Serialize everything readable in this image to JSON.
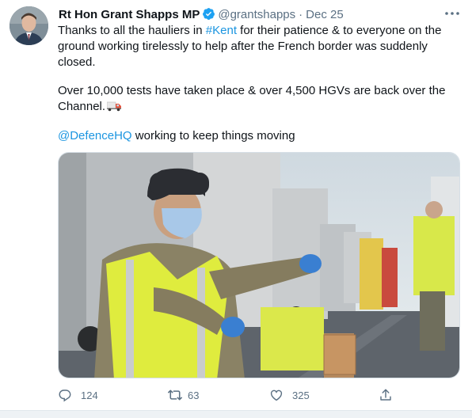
{
  "tweet": {
    "author_name": "Rt Hon Grant Shapps MP",
    "handle": "@grantshapps",
    "separator": "·",
    "date": "Dec 25",
    "text_line1_a": "Thanks to all the hauliers in ",
    "hashtag": "#Kent",
    "text_line1_b": " for their patience & to everyone on the ground working tirelessly to help after the French border was suddenly closed.",
    "text_line2": "Over 10,000 tests have taken place & over 4,500 HGVs are back over the Channel.",
    "mention": "@DefenceHQ",
    "text_line3": " working to keep things moving"
  },
  "actions": {
    "reply_count": "124",
    "retweet_count": "63",
    "like_count": "325"
  },
  "icons": {
    "verified": "verified-badge-icon",
    "more": "more-options-icon",
    "reply": "reply-icon",
    "retweet": "retweet-icon",
    "like": "like-icon",
    "share": "share-icon",
    "truck": "truck-emoji-icon"
  },
  "colors": {
    "link": "#1b95e0",
    "secondary_text": "#5b7083",
    "primary_text": "#0f1419",
    "verified": "#1da1f2"
  }
}
